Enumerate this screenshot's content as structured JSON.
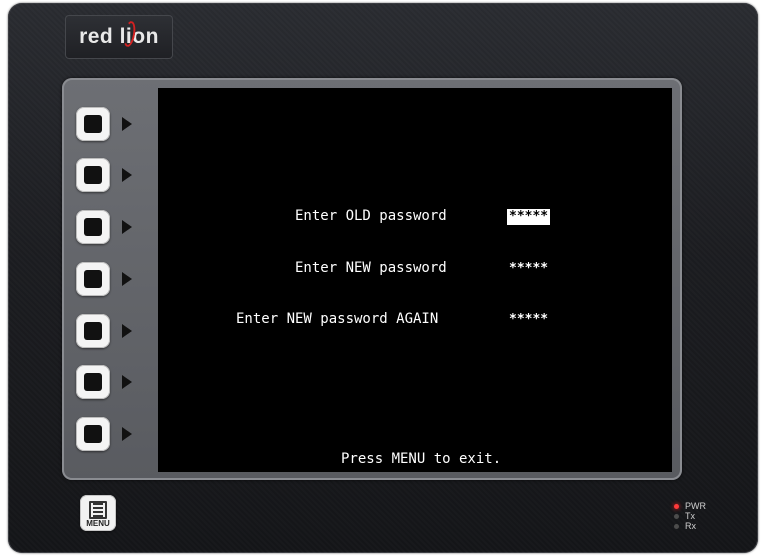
{
  "device": {
    "brand": "red lion",
    "menu_button_label": "MENU",
    "leds": [
      {
        "label": "PWR",
        "state": "on",
        "color": "#ff3a3a"
      },
      {
        "label": "Tx",
        "state": "off",
        "color": "#4c4c4c"
      },
      {
        "label": "Rx",
        "state": "off",
        "color": "#4c4c4c"
      }
    ],
    "softkey_count": 7
  },
  "screen": {
    "prompts": [
      {
        "label": "Enter OLD password",
        "value": "*****",
        "active": true
      },
      {
        "label": "Enter NEW password",
        "value": "*****",
        "active": false
      },
      {
        "label": "Enter NEW password AGAIN",
        "value": "*****",
        "active": false
      }
    ],
    "footer": "Press MENU to exit."
  }
}
